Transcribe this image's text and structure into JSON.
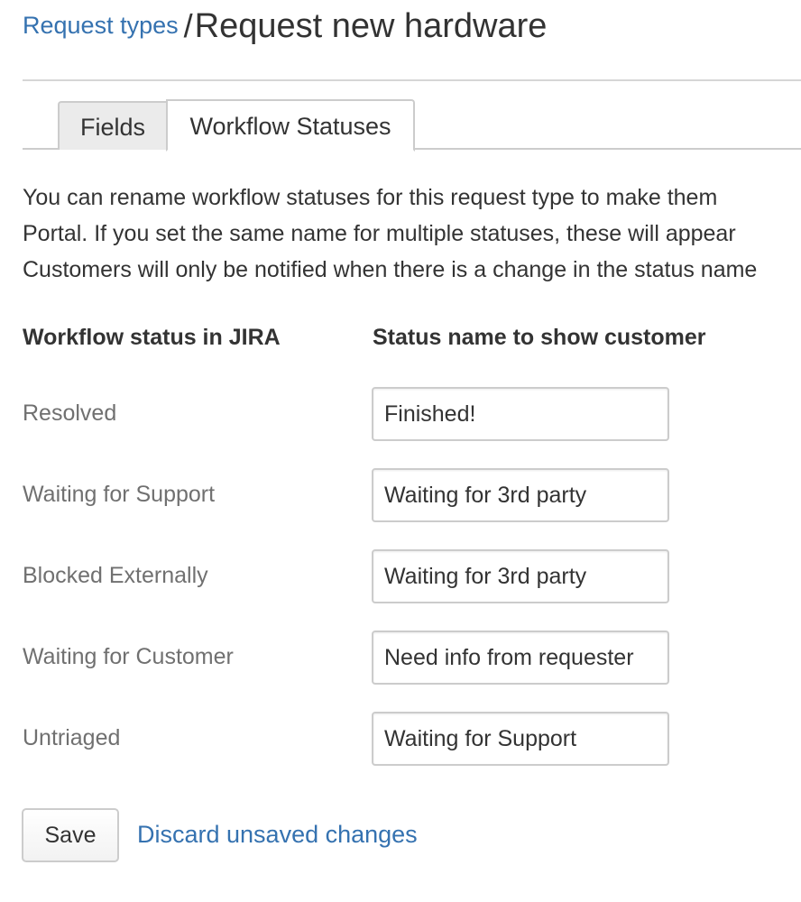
{
  "header": {
    "breadcrumb_link": "Request types",
    "separator": "/",
    "title": "Request new hardware"
  },
  "tabs": [
    {
      "label": "Fields",
      "active": false
    },
    {
      "label": "Workflow Statuses",
      "active": true
    }
  ],
  "description": {
    "line1": "You can rename workflow statuses for this request type to make them",
    "line2": "Portal. If you set the same name for multiple statuses, these will appear",
    "line3": "Customers will only be notified when there is a change in the status name"
  },
  "table": {
    "col_jira": "Workflow status in JIRA",
    "col_customer": "Status name to show customer",
    "rows": [
      {
        "jira_status": "Resolved",
        "customer_name": "Finished!"
      },
      {
        "jira_status": "Waiting for Support",
        "customer_name": "Waiting for 3rd party"
      },
      {
        "jira_status": "Blocked Externally",
        "customer_name": "Waiting for 3rd party"
      },
      {
        "jira_status": "Waiting for Customer",
        "customer_name": "Need info from requester"
      },
      {
        "jira_status": "Untriaged",
        "customer_name": "Waiting for Support"
      }
    ]
  },
  "actions": {
    "save_label": "Save",
    "discard_label": "Discard unsaved changes"
  },
  "colors": {
    "link": "#3572b0",
    "muted_label": "#707070",
    "border": "#cccccc"
  }
}
